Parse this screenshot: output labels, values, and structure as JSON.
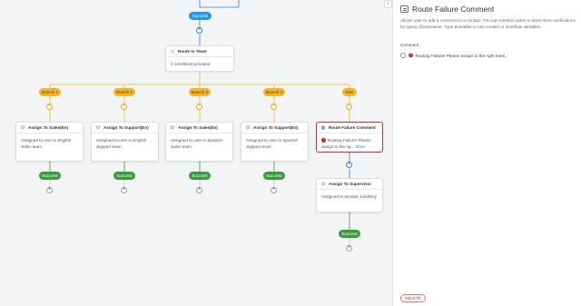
{
  "canvas": {
    "top_status": "Success",
    "route_card": {
      "title": "Route to Team",
      "body": "4 conditions provided"
    },
    "branches": [
      {
        "label": "Branch 1",
        "card_title": "Assign To Sales(En)",
        "body_pre": "Assigned to user in ",
        "body_em": "English Sales",
        "body_post": " team",
        "status": "Success"
      },
      {
        "label": "Branch 2",
        "card_title": "Assign To Support(En)",
        "body_pre": "Assigned to user in ",
        "body_em": "English Support",
        "body_post": " team",
        "status": "Success"
      },
      {
        "label": "Branch 3",
        "card_title": "Assign To Sales(Es)",
        "body_pre": "Assigned to user in ",
        "body_em": "Spanish Sales",
        "body_post": " team",
        "status": "Success"
      },
      {
        "label": "Branch 4",
        "card_title": "Assign To Support(Es)",
        "body_pre": "Assigned to user in ",
        "body_em": "Spanish Support",
        "body_post": " team",
        "status": "Success"
      },
      {
        "label": "Else",
        "card_title": "Route Failure Comment",
        "body_text": "Routing Failure! Please assign to the rig...",
        "more": "More"
      }
    ],
    "supervisor_card": {
      "title": "Assign To Supervisor",
      "body": "Assigned to Iaroslav Kubitskiy"
    },
    "supervisor_status": "Success",
    "collapse_icon": "chevron-right-icon"
  },
  "panel": {
    "title": "Route Failure Comment",
    "description": "Allows user to add a comment to a contact. You can mention users to send them notifications by typing @username. Type $variable to use contact or workflow variables.",
    "comment_label": "Comment",
    "comment_text": "Routing Failure! Please assign to the right team.",
    "delete_label": "DELETE"
  },
  "colors": {
    "success": "#3a9a3d",
    "branch": "#f6b62b",
    "accent": "#2f80ed",
    "selected_border": "#d32f2f"
  }
}
